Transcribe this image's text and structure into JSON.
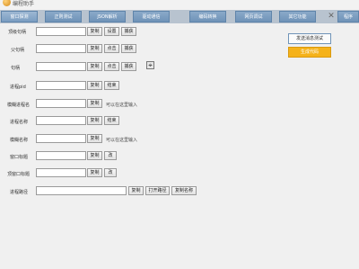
{
  "app": {
    "title": "编程助手 ",
    "logo": "app-logo"
  },
  "tabs": [
    {
      "label": "窗口探测"
    },
    {
      "label": "正则测试"
    },
    {
      "label": "JSON解析"
    },
    {
      "label": "驱动通信"
    },
    {
      "label": "编码转换"
    },
    {
      "label": "网页调试"
    },
    {
      "label": "其它功能"
    },
    {
      "label": "程序"
    }
  ],
  "tab_close_icon": "close-icon",
  "rows": {
    "top_handle": {
      "label": "顶级句柄",
      "value": "",
      "btn1": "复制",
      "btn2": "设置",
      "btn3": "捕获"
    },
    "parent_handle": {
      "label": "父句柄",
      "value": "",
      "btn1": "复制",
      "btn2": "点击",
      "btn3": "捕获"
    },
    "handle": {
      "label": "句柄",
      "value": "",
      "btn1": "复制",
      "btn2": "点击",
      "btn3": "捕获"
    },
    "pid": {
      "label": "进程pid",
      "value": "",
      "btn1": "复制",
      "btn2": "结束"
    },
    "fuzzy_process": {
      "label": "模糊进程名",
      "value": "",
      "btn1": "复制",
      "hint": "可以在这里输入"
    },
    "process_name": {
      "label": "进程名称",
      "value": "",
      "btn1": "复制",
      "btn2": "结束"
    },
    "fuzzy_name": {
      "label": "模糊名称",
      "value": "",
      "btn1": "复制",
      "hint": "可以在这里输入"
    },
    "window_title": {
      "label": "窗口标题",
      "value": "",
      "btn1": "复制",
      "btn2": "改"
    },
    "top_window_title": {
      "label": "顶窗口标题",
      "value": "",
      "btn1": "复制",
      "btn2": "改"
    },
    "process_path": {
      "label": "进程路径",
      "value": "",
      "btn1": "复制",
      "btn2": "打开路径",
      "btn3": "复制名称"
    }
  },
  "side": {
    "send_test": "发送消息测试",
    "generate_code": "生成代码"
  },
  "crosshair_icon": "crosshair-icon",
  "colors": {
    "tab_bg": "#6f93b8",
    "accent_orange": "#f5b21a"
  }
}
